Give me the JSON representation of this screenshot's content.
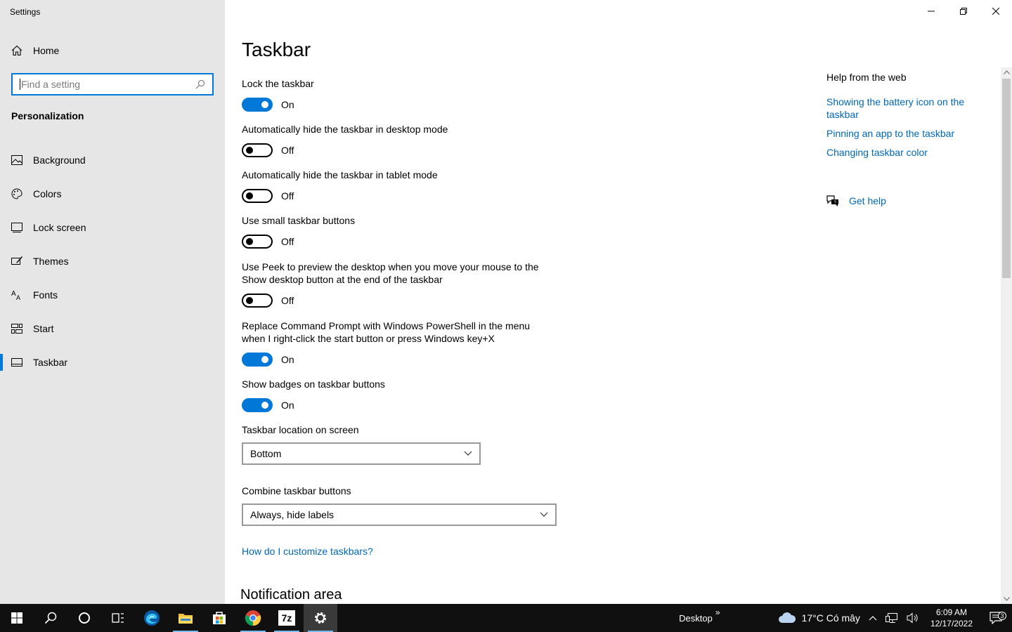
{
  "window": {
    "app_title": "Settings"
  },
  "sidebar": {
    "home_label": "Home",
    "search_placeholder": "Find a setting",
    "section_label": "Personalization",
    "items": [
      {
        "label": "Background",
        "icon": "image-icon"
      },
      {
        "label": "Colors",
        "icon": "palette-icon"
      },
      {
        "label": "Lock screen",
        "icon": "lock-screen-icon"
      },
      {
        "label": "Themes",
        "icon": "brush-icon"
      },
      {
        "label": "Fonts",
        "icon": "font-icon"
      },
      {
        "label": "Start",
        "icon": "start-tiles-icon"
      },
      {
        "label": "Taskbar",
        "icon": "taskbar-icon",
        "active": true
      }
    ]
  },
  "main": {
    "title": "Taskbar",
    "settings": [
      {
        "label": "Lock the taskbar",
        "state": "On"
      },
      {
        "label": "Automatically hide the taskbar in desktop mode",
        "state": "Off"
      },
      {
        "label": "Automatically hide the taskbar in tablet mode",
        "state": "Off"
      },
      {
        "label": "Use small taskbar buttons",
        "state": "Off"
      },
      {
        "label": "Use Peek to preview the desktop when you move your mouse to the Show desktop button at the end of the taskbar",
        "state": "Off"
      },
      {
        "label": "Replace Command Prompt with Windows PowerShell in the menu when I right-click the start button or press Windows key+X",
        "state": "On"
      },
      {
        "label": "Show badges on taskbar buttons",
        "state": "On"
      }
    ],
    "location": {
      "label": "Taskbar location on screen",
      "value": "Bottom"
    },
    "combine": {
      "label": "Combine taskbar buttons",
      "value": "Always, hide labels"
    },
    "customize_link": "How do I customize taskbars?",
    "next_section": "Notification area"
  },
  "help": {
    "title": "Help from the web",
    "links": [
      "Showing the battery icon on the taskbar",
      "Pinning an app to the taskbar",
      "Changing taskbar color"
    ],
    "get_help": "Get help"
  },
  "taskbar": {
    "apps": [
      "start-icon",
      "search-icon",
      "cortana-icon",
      "task-view-icon",
      "edge-icon",
      "file-explorer-icon",
      "store-icon",
      "chrome-icon",
      "7zip-icon",
      "settings-icon"
    ],
    "seven_zip_label": "7z",
    "desktop_label": "Desktop",
    "desktop_chevron": "»",
    "weather": "17°C  Có mây",
    "time": "6:09 AM",
    "date": "12/17/2022",
    "notification_count": "3"
  },
  "colors": {
    "accent": "#0078d7",
    "link": "#0067b8",
    "sidebar_bg": "#e6e6e6",
    "taskbar_bg": "#101010"
  }
}
